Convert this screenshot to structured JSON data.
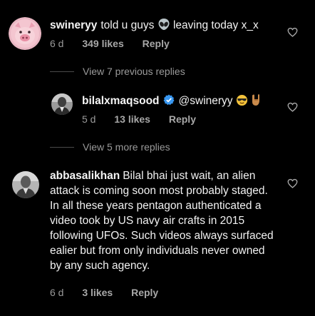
{
  "comments": [
    {
      "username": "swineryy",
      "text_before": "told u guys",
      "text_after": "leaving today x_x",
      "emoji_names": [
        "alien-emoji"
      ],
      "age": "6 d",
      "likes": "349 likes",
      "reply_label": "Reply"
    },
    {
      "username": "bilalxmaqsood",
      "verified": true,
      "text": "@swineryy",
      "emoji_names": [
        "sunglasses-emoji",
        "rock-on-hand-emoji"
      ],
      "age": "5 d",
      "likes": "13 likes",
      "reply_label": "Reply"
    },
    {
      "username": "abbasalikhan",
      "text": "Bilal bhai just wait, an alien attack is coming soon most probably staged. In all these years pentagon authenticated a video took by US navy air crafts in 2015 following UFOs. Such videos always surfaced ealier but from only individuals never owned by any such agency.",
      "age": "6 d",
      "likes": "3 likes",
      "reply_label": "Reply"
    }
  ],
  "view_replies": [
    {
      "label": "View 7 previous replies"
    },
    {
      "label": "View 5 more replies"
    }
  ],
  "colors": {
    "background": "#000000",
    "meta_text": "#9a9a9a",
    "verified_badge": "#3897f0",
    "heart_outline": "#a8a8a8"
  }
}
